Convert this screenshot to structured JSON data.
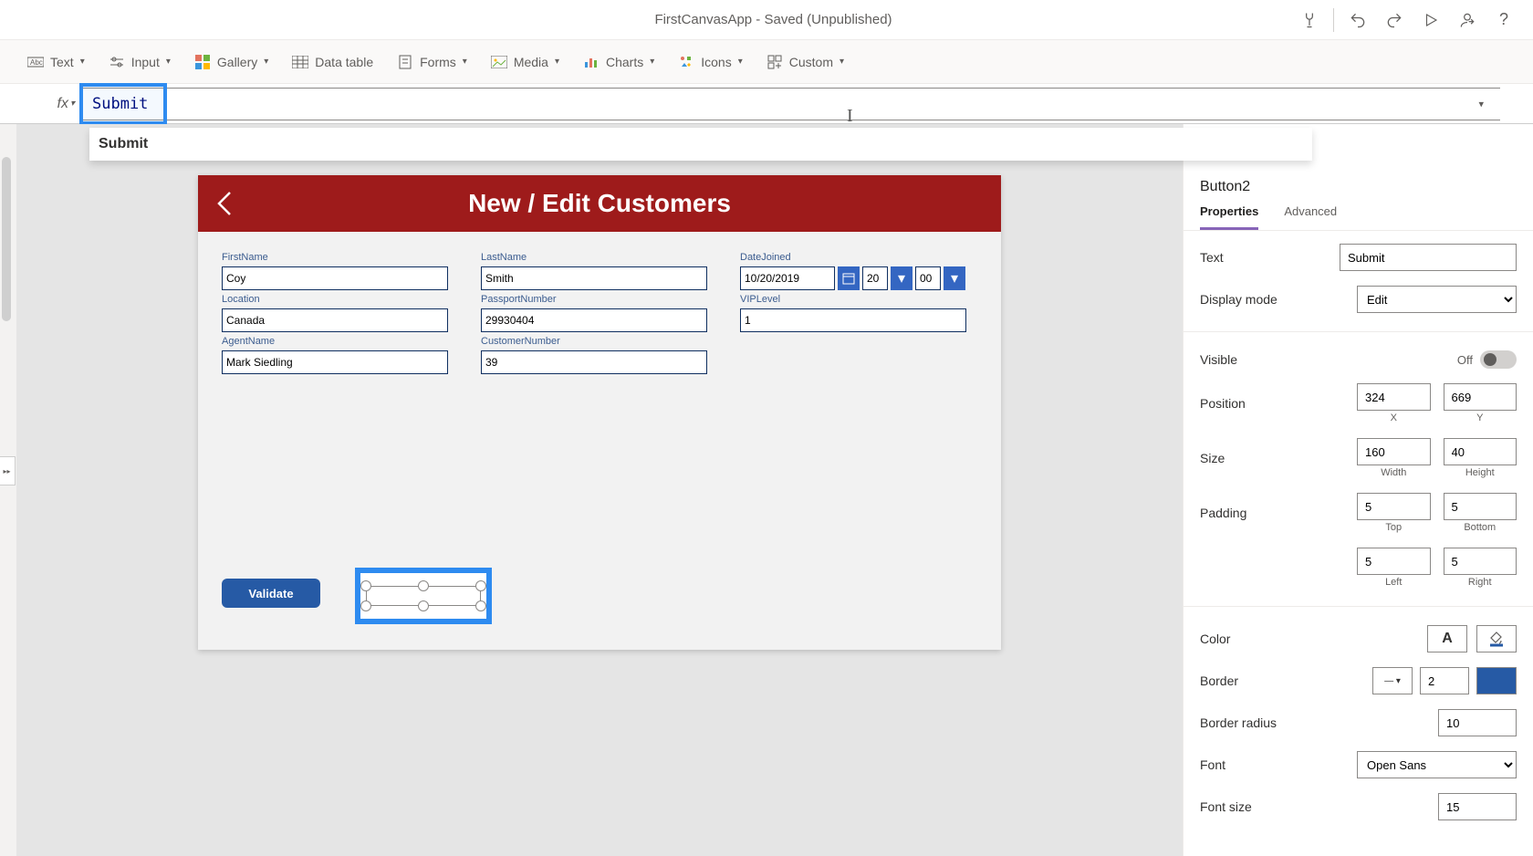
{
  "titlebar": {
    "title": "FirstCanvasApp - Saved (Unpublished)"
  },
  "ribbon": {
    "text": "Text",
    "input": "Input",
    "gallery": "Gallery",
    "datatable": "Data table",
    "forms": "Forms",
    "media": "Media",
    "charts": "Charts",
    "icons": "Icons",
    "custom": "Custom"
  },
  "formula": {
    "fx": "fx",
    "value": "Submit",
    "suggestion": "Submit"
  },
  "app": {
    "title": "New / Edit Customers",
    "fields": {
      "firstname_label": "FirstName",
      "firstname": "Coy",
      "lastname_label": "LastName",
      "lastname": "Smith",
      "datejoined_label": "DateJoined",
      "datejoined": "10/20/2019",
      "date_hour": "20",
      "date_min": "00",
      "location_label": "Location",
      "location": "Canada",
      "passport_label": "PassportNumber",
      "passport": "29930404",
      "viplevel_label": "VIPLevel",
      "viplevel": "1",
      "agent_label": "AgentName",
      "agent": "Mark Siedling",
      "custno_label": "CustomerNumber",
      "custno": "39"
    },
    "validate": "Validate"
  },
  "rightpanel": {
    "title": "Button2",
    "tabs": {
      "properties": "Properties",
      "advanced": "Advanced"
    },
    "text_label": "Text",
    "text_value": "Submit",
    "display_label": "Display mode",
    "display_value": "Edit",
    "visible_label": "Visible",
    "visible_state": "Off",
    "position_label": "Position",
    "x": "324",
    "x_sub": "X",
    "y": "669",
    "y_sub": "Y",
    "size_label": "Size",
    "w": "160",
    "w_sub": "Width",
    "h": "40",
    "h_sub": "Height",
    "padding_label": "Padding",
    "pad_top": "5",
    "pad_top_sub": "Top",
    "pad_bot": "5",
    "pad_bot_sub": "Bottom",
    "pad_left": "5",
    "pad_left_sub": "Left",
    "pad_right": "5",
    "pad_right_sub": "Right",
    "color_label": "Color",
    "border_label": "Border",
    "border_width": "2",
    "radius_label": "Border radius",
    "radius_value": "10",
    "font_label": "Font",
    "font_value": "Open Sans",
    "fontsize_label": "Font size",
    "fontsize_value": "15"
  }
}
